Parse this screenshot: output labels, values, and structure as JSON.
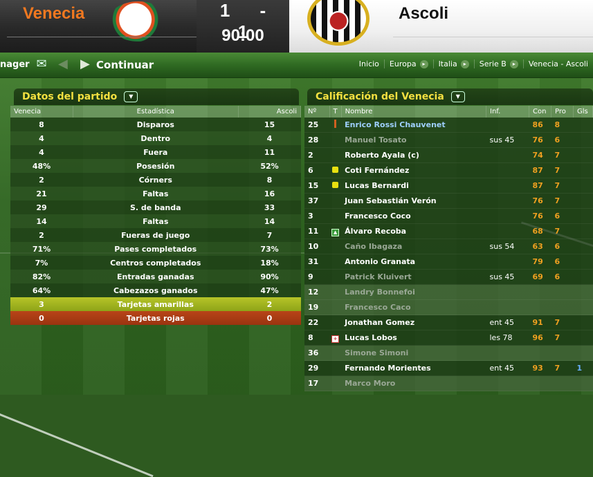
{
  "scoreboard": {
    "home_team": "Venecia",
    "away_team": "Ascoli",
    "score": "1 - 1",
    "clock": "90:00",
    "home_color": "#f07820"
  },
  "navbar": {
    "manager_label": "nager",
    "continue_label": "Continuar",
    "crumbs": [
      "Inicio",
      "Europa",
      "Italia",
      "Serie B",
      "Venecia - Ascoli"
    ]
  },
  "stats_panel": {
    "title": "Datos del partido",
    "headers": [
      "Venecia",
      "Estadística",
      "Ascoli"
    ],
    "rows": [
      {
        "home": "8",
        "label": "Disparos",
        "away": "15"
      },
      {
        "home": "4",
        "label": "Dentro",
        "away": "4"
      },
      {
        "home": "4",
        "label": "Fuera",
        "away": "11"
      },
      {
        "home": "48%",
        "label": "Posesión",
        "away": "52%"
      },
      {
        "home": "2",
        "label": "Córners",
        "away": "8"
      },
      {
        "home": "21",
        "label": "Faltas",
        "away": "16"
      },
      {
        "home": "29",
        "label": "S. de banda",
        "away": "33"
      },
      {
        "home": "14",
        "label": "Faltas",
        "away": "14"
      },
      {
        "home": "2",
        "label": "Fueras de juego",
        "away": "7"
      },
      {
        "home": "71%",
        "label": "Pases completados",
        "away": "73%"
      },
      {
        "home": "7%",
        "label": "Centros completados",
        "away": "18%"
      },
      {
        "home": "82%",
        "label": "Entradas ganadas",
        "away": "90%"
      },
      {
        "home": "64%",
        "label": "Cabezazos ganados",
        "away": "47%"
      },
      {
        "home": "3",
        "label": "Tarjetas amarillas",
        "away": "2"
      },
      {
        "home": "0",
        "label": "Tarjetas rojas",
        "away": "0"
      }
    ]
  },
  "ratings_panel": {
    "title": "Calificación del Venecia",
    "headers": [
      "Nº",
      "T",
      "Nombre",
      "Inf.",
      "Con",
      "Pro",
      "Gls"
    ],
    "rows": [
      {
        "num": "25",
        "icon": "captain",
        "name": "Enrico Rossi Chauvenet",
        "inf": "",
        "con": "86",
        "pro": "8",
        "gls": "",
        "style": "hl"
      },
      {
        "num": "28",
        "icon": "",
        "name": "Manuel Tosato",
        "inf": "sus 45",
        "con": "76",
        "pro": "6",
        "gls": "",
        "style": "dim"
      },
      {
        "num": "2",
        "icon": "",
        "name": "Roberto Ayala (c)",
        "inf": "",
        "con": "74",
        "pro": "7",
        "gls": "",
        "style": ""
      },
      {
        "num": "6",
        "icon": "yellow",
        "name": "Coti Fernández",
        "inf": "",
        "con": "87",
        "pro": "7",
        "gls": "",
        "style": ""
      },
      {
        "num": "15",
        "icon": "yellow",
        "name": "Lucas Bernardi",
        "inf": "",
        "con": "87",
        "pro": "7",
        "gls": "",
        "style": ""
      },
      {
        "num": "37",
        "icon": "",
        "name": "Juan Sebastián Verón",
        "inf": "",
        "con": "76",
        "pro": "7",
        "gls": "",
        "style": ""
      },
      {
        "num": "3",
        "icon": "",
        "name": "Francesco Coco",
        "inf": "",
        "con": "76",
        "pro": "6",
        "gls": "",
        "style": ""
      },
      {
        "num": "11",
        "icon": "sub-in",
        "name": "Álvaro Recoba",
        "inf": "",
        "con": "68",
        "pro": "7",
        "gls": "",
        "style": ""
      },
      {
        "num": "10",
        "icon": "",
        "name": "Caño Ibagaza",
        "inf": "sus 54",
        "con": "63",
        "pro": "6",
        "gls": "",
        "style": "dim"
      },
      {
        "num": "31",
        "icon": "",
        "name": "Antonio Granata",
        "inf": "",
        "con": "79",
        "pro": "6",
        "gls": "",
        "style": ""
      },
      {
        "num": "9",
        "icon": "",
        "name": "Patrick Kluivert",
        "inf": "sus 45",
        "con": "69",
        "pro": "6",
        "gls": "",
        "style": "dim"
      },
      {
        "num": "12",
        "icon": "",
        "name": "Landry Bonnefoi",
        "inf": "",
        "con": "",
        "pro": "",
        "gls": "",
        "style": "bench"
      },
      {
        "num": "19",
        "icon": "",
        "name": "Francesco Caco",
        "inf": "",
        "con": "",
        "pro": "",
        "gls": "",
        "style": "bench"
      },
      {
        "num": "22",
        "icon": "",
        "name": "Jonathan Gomez",
        "inf": "ent 45",
        "con": "91",
        "pro": "7",
        "gls": "",
        "style": ""
      },
      {
        "num": "8",
        "icon": "sub-out",
        "name": "Lucas Lobos",
        "inf": "les 78",
        "con": "96",
        "pro": "7",
        "gls": "",
        "style": ""
      },
      {
        "num": "36",
        "icon": "",
        "name": "Simone Simoni",
        "inf": "",
        "con": "",
        "pro": "",
        "gls": "",
        "style": "bench"
      },
      {
        "num": "29",
        "icon": "",
        "name": "Fernando Morientes",
        "inf": "ent 45",
        "con": "93",
        "pro": "7",
        "gls": "1",
        "style": ""
      },
      {
        "num": "17",
        "icon": "",
        "name": "Marco Moro",
        "inf": "",
        "con": "",
        "pro": "",
        "gls": "",
        "style": "bench"
      }
    ]
  }
}
